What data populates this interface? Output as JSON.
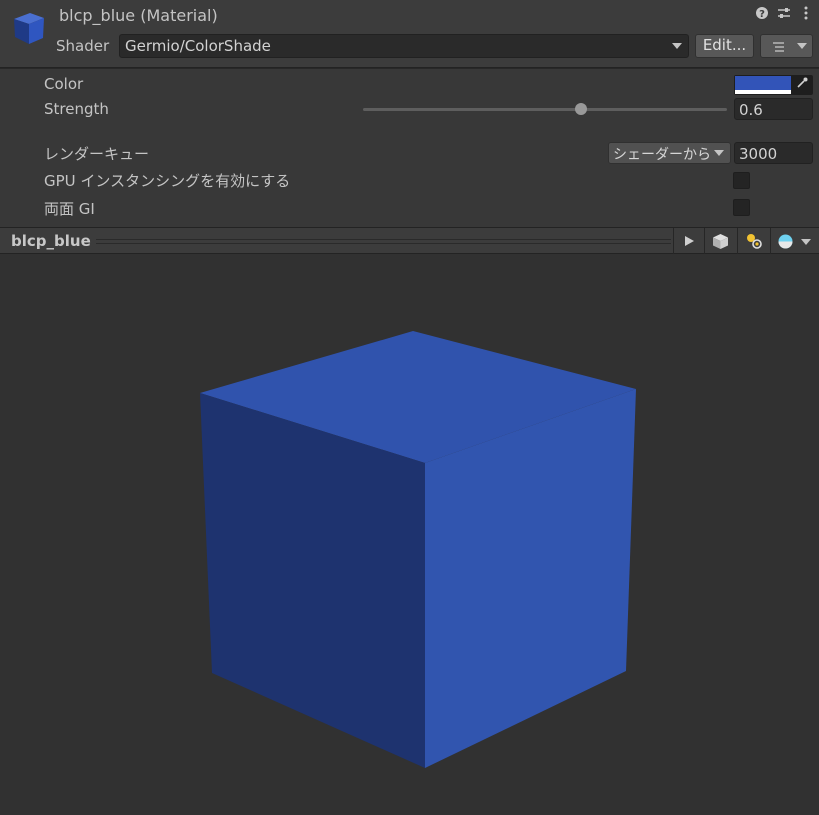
{
  "header": {
    "title": "blcp_blue (Material)",
    "shader_label": "Shader",
    "shader_value": "Germio/ColorShade",
    "edit_label": "Edit...",
    "icons": [
      "help-icon",
      "preset-icon",
      "more-icon",
      "list-menu-icon"
    ]
  },
  "properties": {
    "color_label": "Color",
    "color_value": "#3254b8",
    "strength_label": "Strength",
    "strength_value": "0.6",
    "strength_fraction": 0.6,
    "render_queue_label": "レンダーキュー",
    "render_queue_option": "シェーダーから",
    "render_queue_value": "3000",
    "gpu_instancing_label": "GPU インスタンシングを有効にする",
    "gpu_instancing_checked": false,
    "double_sided_gi_label": "両面 GI",
    "double_sided_gi_checked": false
  },
  "preview": {
    "title": "blcp_blue",
    "toolbar_icons": [
      "play-icon",
      "cube-mesh-icon",
      "light-icon",
      "sphere-icon"
    ],
    "cube_colors": {
      "top": "#3053ad",
      "left": "#1e336f",
      "right": "#3155af"
    }
  }
}
